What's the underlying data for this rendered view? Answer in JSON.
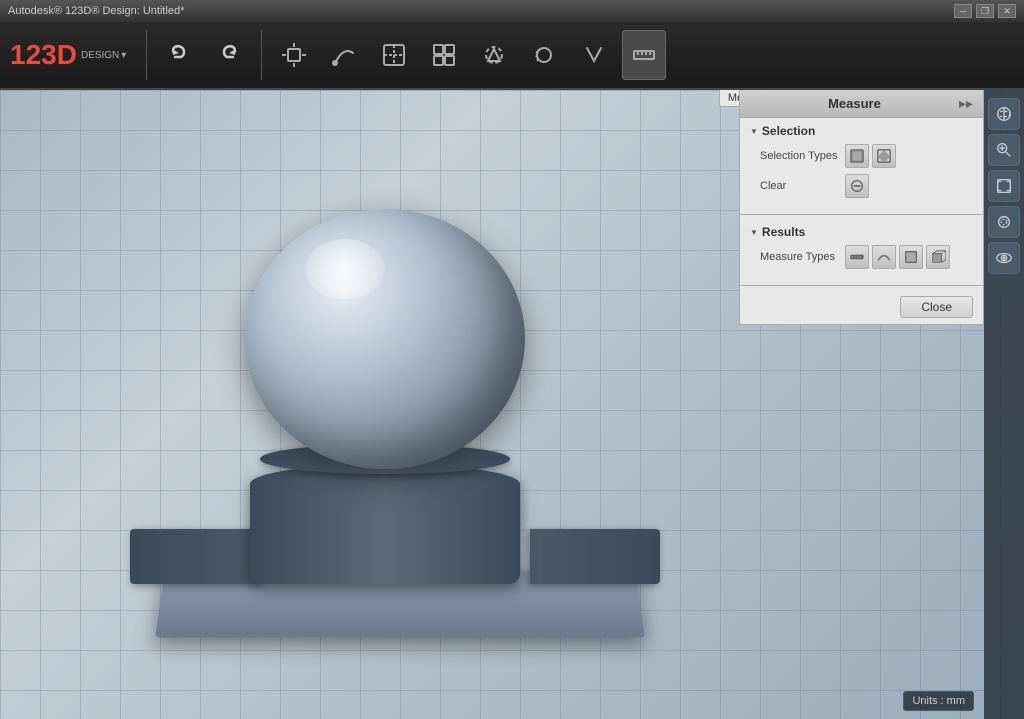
{
  "titlebar": {
    "title": "Autodesk® 123D® Design: Untitled*",
    "minimize": "─",
    "restore": "❐",
    "close": "✕"
  },
  "logo": {
    "text": "123D",
    "sub": "DESIGN",
    "arrow": "▾"
  },
  "toolbar": {
    "undo_label": "↺",
    "redo_label": "↻",
    "tools": [
      "box",
      "lasso",
      "extrude",
      "cube",
      "grid",
      "star",
      "pentagon",
      "arc",
      "measure"
    ]
  },
  "measure_tab": {
    "label": "Measu..."
  },
  "panel": {
    "title": "Measure",
    "expand_icon": "▸▸",
    "selection_label": "Selection",
    "selection_types_label": "Selection Types",
    "clear_label": "Clear",
    "results_label": "Results",
    "measure_types_label": "Measure Types",
    "close_label": "Close"
  },
  "right_toolbar": {
    "buttons": [
      "⊕",
      "🔍",
      "⊡",
      "◉",
      "👁"
    ]
  },
  "units": {
    "label": "Units : mm"
  }
}
